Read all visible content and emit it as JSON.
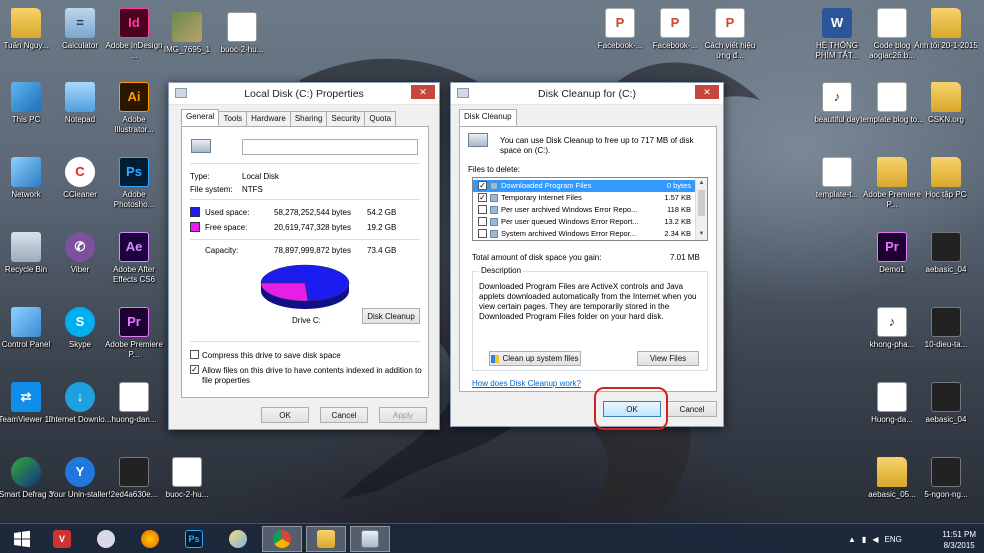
{
  "desktop": {
    "icons": [
      {
        "label": "Tuấn Nguy...",
        "kind": "folder",
        "glyph": ""
      },
      {
        "label": "Calculator",
        "kind": "calc",
        "glyph": "="
      },
      {
        "label": "Adobe InDesign ...",
        "kind": "id",
        "glyph": "Id"
      },
      {
        "label": "IMG_7695_1",
        "kind": "photo",
        "glyph": ""
      },
      {
        "label": "buoc-2-hu...",
        "kind": "web",
        "glyph": ""
      },
      {
        "label": "This PC",
        "kind": "pc",
        "glyph": ""
      },
      {
        "label": "Notepad",
        "kind": "note",
        "glyph": ""
      },
      {
        "label": "Adobe Illustrator...",
        "kind": "ai",
        "glyph": "Ai"
      },
      {
        "label": "Network",
        "kind": "net",
        "glyph": ""
      },
      {
        "label": "CCleaner",
        "kind": "cc",
        "glyph": "C"
      },
      {
        "label": "Adobe Photosho...",
        "kind": "ps",
        "glyph": "Ps"
      },
      {
        "label": "Recycle Bin",
        "kind": "bin",
        "glyph": ""
      },
      {
        "label": "Viber",
        "kind": "viber",
        "glyph": "✆"
      },
      {
        "label": "Adobe After Effects CS6",
        "kind": "ae",
        "glyph": "Ae"
      },
      {
        "label": "Control Panel",
        "kind": "cp",
        "glyph": ""
      },
      {
        "label": "Skype",
        "kind": "skype",
        "glyph": "S"
      },
      {
        "label": "Adobe Premiere P...",
        "kind": "pr",
        "glyph": "Pr"
      },
      {
        "label": "TeamViewer 10",
        "kind": "tv",
        "glyph": "⇄"
      },
      {
        "label": "Internet Downlo...",
        "kind": "ie",
        "glyph": "↓"
      },
      {
        "label": "huong-dan...",
        "kind": "web",
        "glyph": ""
      },
      {
        "label": "Smart Defrag 3",
        "kind": "smart",
        "glyph": ""
      },
      {
        "label": "Your Unin-staller!",
        "kind": "yu",
        "glyph": "Y"
      },
      {
        "label": "2ed4a630e...",
        "kind": "vid",
        "glyph": ""
      },
      {
        "label": "buoc-2-hu...",
        "kind": "web",
        "glyph": ""
      },
      {
        "label": "Facebook-...",
        "kind": "ppt",
        "glyph": "P"
      },
      {
        "label": "Facebook-...",
        "kind": "ppt",
        "glyph": "P"
      },
      {
        "label": "Cách viết hiệu ứng đ...",
        "kind": "ppt",
        "glyph": "P"
      },
      {
        "label": "HỆ THỐNG PHÍM TẮT...",
        "kind": "word",
        "glyph": "W"
      },
      {
        "label": "Code blog aogiac26.b...",
        "kind": "doc",
        "glyph": ""
      },
      {
        "label": "Ảnh tối 20-1-2015",
        "kind": "folder",
        "glyph": ""
      },
      {
        "label": "beautiful day",
        "kind": "mp3",
        "glyph": "♪"
      },
      {
        "label": "template blog to...",
        "kind": "doc",
        "glyph": ""
      },
      {
        "label": "CSKN.org",
        "kind": "folder",
        "glyph": ""
      },
      {
        "label": "template-t...",
        "kind": "doc",
        "glyph": ""
      },
      {
        "label": "Adobe Premiere P...",
        "kind": "folder",
        "glyph": ""
      },
      {
        "label": "Học tập PC",
        "kind": "folder",
        "glyph": ""
      },
      {
        "label": "Demo1",
        "kind": "pr",
        "glyph": "Pr"
      },
      {
        "label": "aebasic_04",
        "kind": "vid",
        "glyph": ""
      },
      {
        "label": "khong-pha...",
        "kind": "mp3",
        "glyph": "♪"
      },
      {
        "label": "10-dieu-ta...",
        "kind": "vid",
        "glyph": ""
      },
      {
        "label": "Huong-da...",
        "kind": "web",
        "glyph": ""
      },
      {
        "label": "aebasic_04",
        "kind": "vid",
        "glyph": ""
      },
      {
        "label": "aebasic_05...",
        "kind": "folder",
        "glyph": ""
      },
      {
        "label": "5-ngon-ng...",
        "kind": "vid",
        "glyph": ""
      }
    ]
  },
  "properties": {
    "title": "Local Disk (C:) Properties",
    "tabs": [
      "General",
      "Tools",
      "Hardware",
      "Sharing",
      "Security",
      "Quota"
    ],
    "name_value": "",
    "type_label": "Type:",
    "type_value": "Local Disk",
    "fs_label": "File system:",
    "fs_value": "NTFS",
    "used_label": "Used space:",
    "used_bytes": "58,278,252,544 bytes",
    "used_gb": "54.2 GB",
    "free_label": "Free space:",
    "free_bytes": "20,619,747,328 bytes",
    "free_gb": "19.2 GB",
    "cap_label": "Capacity:",
    "cap_bytes": "78,897,999,872 bytes",
    "cap_gb": "73.4 GB",
    "used_fraction": 0.739,
    "used_color": "#1c1cf0",
    "free_color": "#e61ee6",
    "drive_label": "Drive C:",
    "cleanup_btn": "Disk Cleanup",
    "compress_label": "Compress this drive to save disk space",
    "compress_checked": "",
    "index_label": "Allow files on this drive to have contents indexed in addition to file properties",
    "index_checked": "✓",
    "ok": "OK",
    "cancel": "Cancel",
    "apply": "Apply"
  },
  "cleanup": {
    "title": "Disk Cleanup for  (C:)",
    "tab": "Disk Cleanup",
    "intro": "You can use Disk Cleanup to free up to 717 MB of disk space on  (C:).",
    "files_label": "Files to delete:",
    "files": [
      {
        "name": "Downloaded Program Files",
        "size": "0 bytes",
        "check": "✓"
      },
      {
        "name": "Temporary Internet Files",
        "size": "1.57 KB",
        "check": "✓"
      },
      {
        "name": "Per user archived Windows Error Repo...",
        "size": "118 KB",
        "check": ""
      },
      {
        "name": "Per user queued Windows Error Report...",
        "size": "13.2 KB",
        "check": ""
      },
      {
        "name": "System archived Windows Error Repor...",
        "size": "2.34 KB",
        "check": ""
      }
    ],
    "total_label": "Total amount of disk space you gain:",
    "total_value": "7.01 MB",
    "desc_legend": "Description",
    "desc_text": "Downloaded Program Files are ActiveX controls and Java applets downloaded automatically from the Internet when you view certain pages. They are temporarily stored in the Downloaded Program Files folder on your hard disk.",
    "clean_system_btn": "Clean up system files",
    "view_files_btn": "View Files",
    "how_link": "How does Disk Cleanup work?",
    "ok": "OK",
    "cancel": "Cancel"
  },
  "taskbar": {
    "lang": "ENG",
    "time": "11:51 PM",
    "date": "8/3/2015"
  }
}
